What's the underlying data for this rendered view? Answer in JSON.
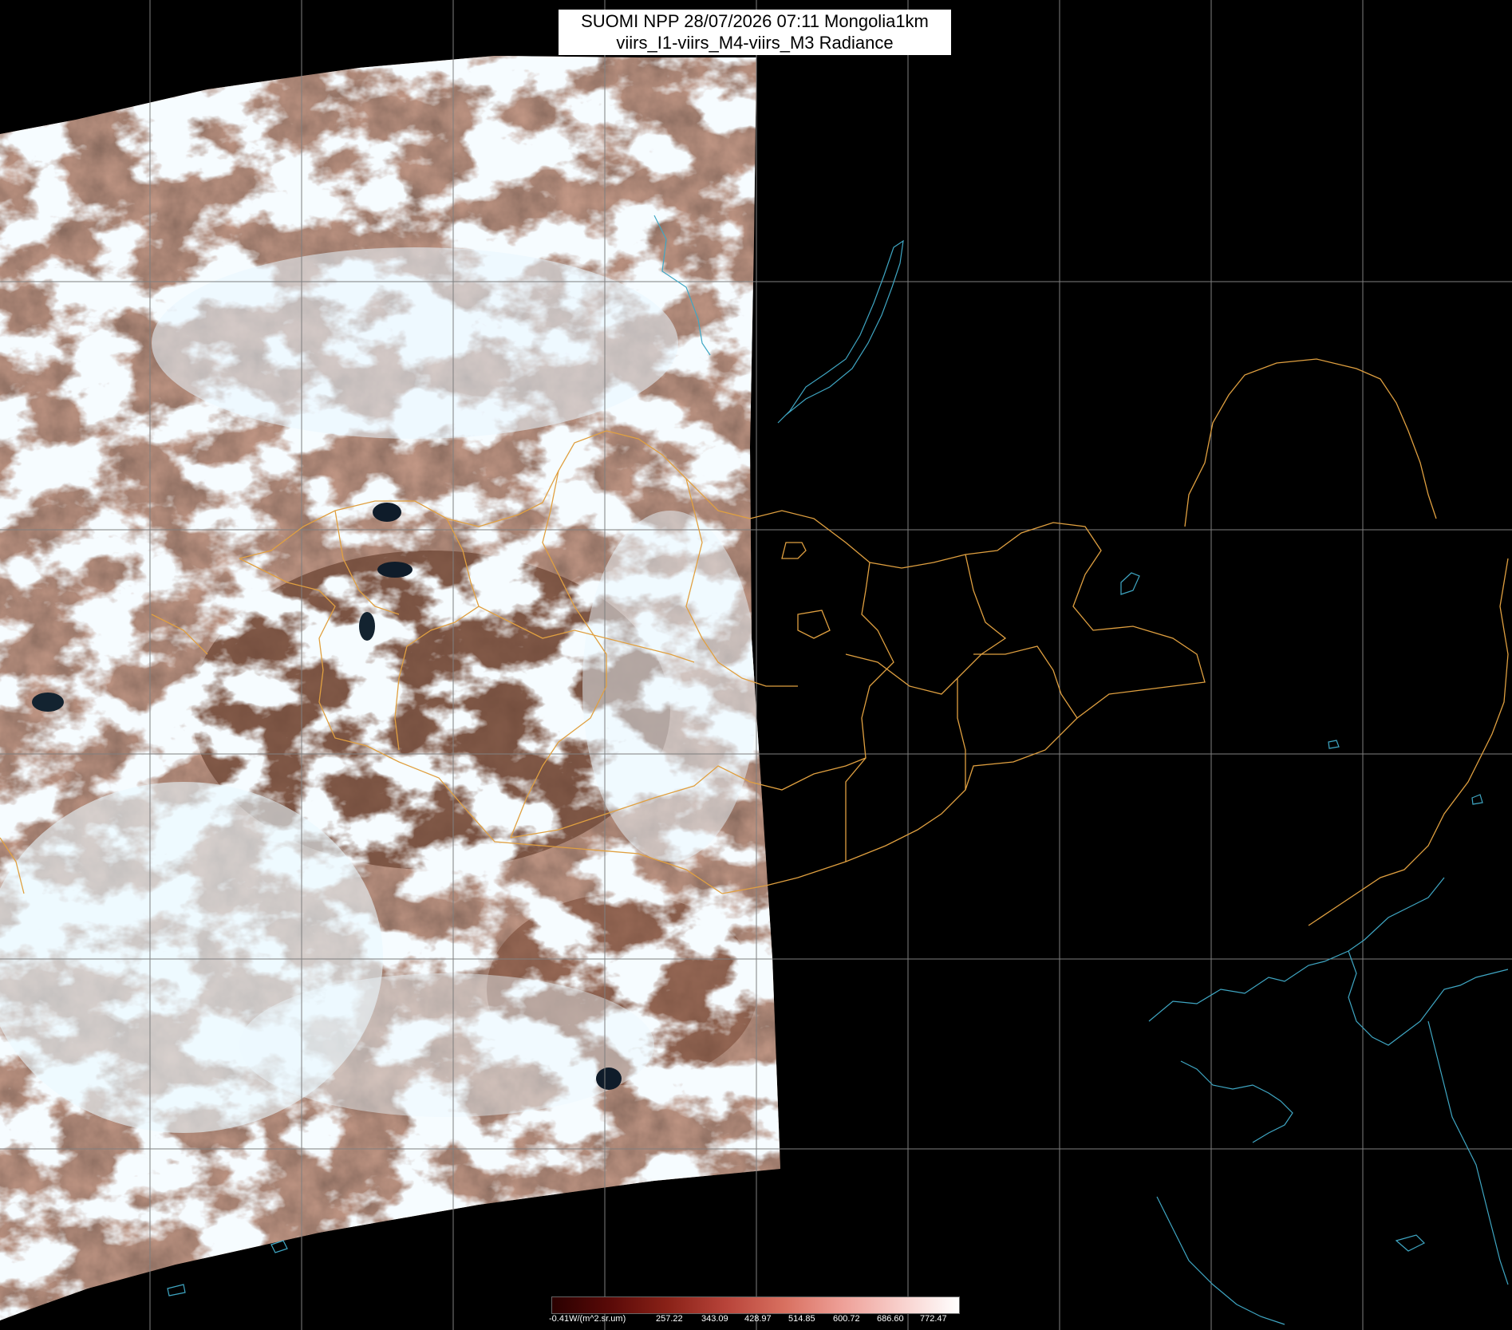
{
  "title": {
    "line1": "SUOMI NPP 28/07/2026 07:11 Mongolia1km",
    "line2": "viirs_I1-viirs_M4-viirs_M3 Radiance"
  },
  "colorbar": {
    "unit_label": "-0.41W/(m^2.sr.um)",
    "ticks": [
      "257.22",
      "343.09",
      "428.97",
      "514.85",
      "600.72",
      "686.60",
      "772.47"
    ],
    "colors": [
      "#2a0000",
      "#5a0a08",
      "#8a2218",
      "#b8443a",
      "#d87060",
      "#eea098",
      "#f8d0cc",
      "#ffffff"
    ]
  },
  "map": {
    "background_color": "#000000",
    "graticule_color": "#7f7f7f",
    "coastline_color": "#3fa7c4",
    "border_color": "#e0a040",
    "swath_colors": {
      "cloud": "#e9f7ff",
      "land": "#6b4232",
      "dark_land": "#2e2420"
    }
  }
}
